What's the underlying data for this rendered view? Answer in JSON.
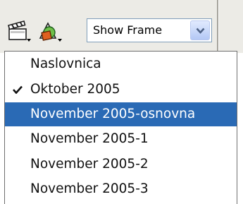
{
  "toolbar": {
    "scene_icon": "clapperboard-icon",
    "symbol_icon": "shapes-icon",
    "select": {
      "value": "Show Frame",
      "arrow_icon": "chevron-down-icon"
    }
  },
  "scene_menu": {
    "items": [
      {
        "label": "Naslovnica",
        "checked": false,
        "highlighted": false
      },
      {
        "label": "Oktober 2005",
        "checked": true,
        "highlighted": false
      },
      {
        "label": "November 2005-osnovna",
        "checked": false,
        "highlighted": true
      },
      {
        "label": "November 2005-1",
        "checked": false,
        "highlighted": false
      },
      {
        "label": "November 2005-2",
        "checked": false,
        "highlighted": false
      },
      {
        "label": "November 2005-3",
        "checked": false,
        "highlighted": false
      }
    ]
  },
  "colors": {
    "highlight": "#2a6ab5",
    "toolbar_bg": "#ecebe6",
    "select_border": "#7f9db9"
  }
}
